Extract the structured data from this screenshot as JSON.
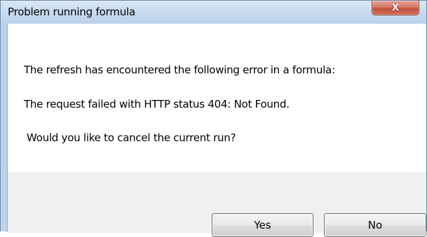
{
  "window": {
    "title": "Problem running formula",
    "close_glyph": "X"
  },
  "message": {
    "line1": "The refresh has encountered the following error in a formula:",
    "line2": "The request failed with HTTP status 404: Not Found.",
    "line3": "Would you like to cancel the current run?"
  },
  "buttons": {
    "yes_label": "Yes",
    "no_label": "No"
  },
  "icons": {
    "close": "close-icon"
  },
  "colors": {
    "titlebar": "#c8dbef",
    "close_button": "#c75a46",
    "footer": "#f0f0f0"
  }
}
